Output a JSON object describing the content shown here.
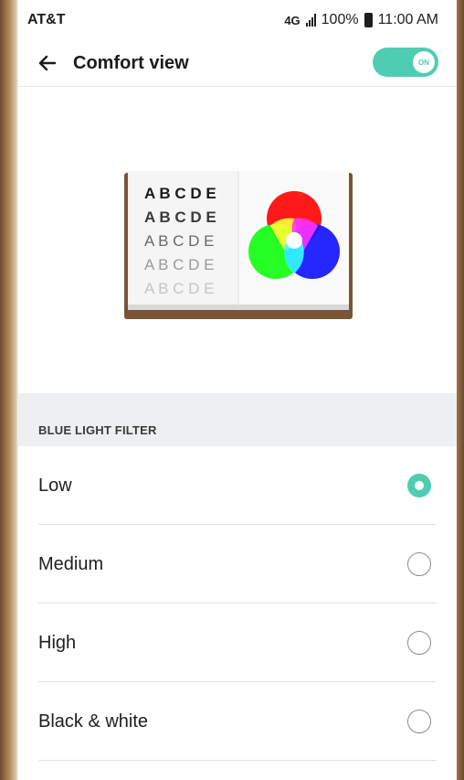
{
  "status_bar": {
    "carrier": "AT&T",
    "network": "4G",
    "battery_percent": "100%",
    "time": "11:00 AM"
  },
  "app_bar": {
    "title": "Comfort view",
    "toggle_label": "ON",
    "toggle_on": true
  },
  "illustration": {
    "letter_rows": [
      "A B C D E",
      "A B C D E",
      "A B C D E",
      "A B C D E",
      "A B C D E"
    ]
  },
  "blue_light_filter": {
    "header": "BLUE LIGHT FILTER",
    "options": [
      {
        "label": "Low",
        "selected": true
      },
      {
        "label": "Medium",
        "selected": false
      },
      {
        "label": "High",
        "selected": false
      },
      {
        "label": "Black & white",
        "selected": false
      }
    ]
  },
  "colors": {
    "accent": "#4fcdb2",
    "book_cover": "#7a5535"
  }
}
